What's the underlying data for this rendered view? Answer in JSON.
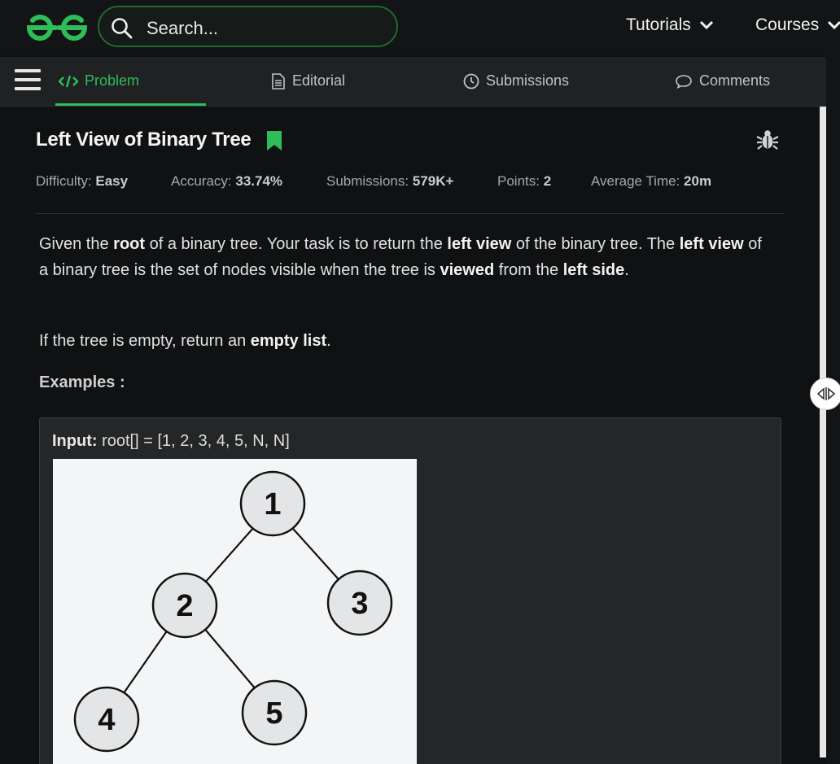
{
  "header": {
    "logo_icon": "gfg-logo-icon",
    "search_placeholder": "Search...",
    "nav": [
      {
        "label": "Tutorials"
      },
      {
        "label": "Courses"
      }
    ]
  },
  "tabs": [
    {
      "label": "Problem",
      "icon": "code-icon",
      "active": true
    },
    {
      "label": "Editorial",
      "icon": "document-icon"
    },
    {
      "label": "Submissions",
      "icon": "clock-icon"
    },
    {
      "label": "Comments",
      "icon": "chat-bubble-icon"
    }
  ],
  "problem": {
    "title": "Left View of Binary Tree",
    "meta": {
      "difficulty_label": "Difficulty:",
      "difficulty": "Easy",
      "accuracy_label": "Accuracy:",
      "accuracy": "33.74%",
      "submissions_label": "Submissions:",
      "submissions": "579K+",
      "points_label": "Points:",
      "points": "2",
      "avg_time_label": "Average Time:",
      "avg_time": "20m"
    },
    "para1": {
      "t1": "Given the ",
      "b1": "root",
      "t2": " of a binary tree. Your task is to return the ",
      "b2": "left view",
      "t3": " of the binary tree. The ",
      "b3": "left view",
      "t4": " of a binary tree is the set of nodes visible when the tree is ",
      "b4": "viewed",
      "t5": " from the ",
      "b5": "left side",
      "t6": "."
    },
    "para2": {
      "t1": "If the tree is empty, return an ",
      "b1": "empty list",
      "t2": "."
    },
    "examples_heading": "Examples :",
    "example1": {
      "input_label": "Input:",
      "input_value": " root[] = [1, 2, 3, 4, 5, N, N]",
      "tree_nodes": [
        "1",
        "2",
        "3",
        "4",
        "5"
      ]
    }
  },
  "colors": {
    "accent": "#2fbd5a",
    "background": "#0f1113",
    "tabbar": "#1f2123"
  }
}
